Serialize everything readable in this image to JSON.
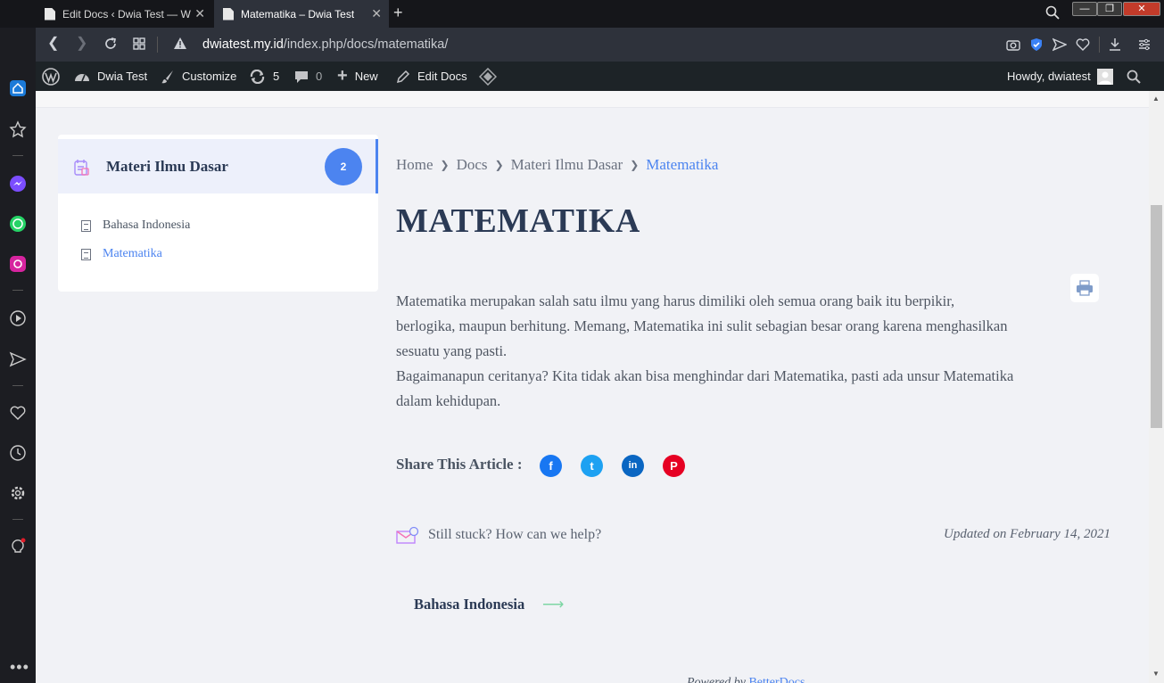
{
  "browser": {
    "tabs": [
      {
        "label": "Edit Docs ‹ Dwia Test — W",
        "close": "✕"
      },
      {
        "label": "Matematika – Dwia Test",
        "close": "✕"
      }
    ],
    "new_tab": "+",
    "url_domain": "dwiatest.my.id",
    "url_path": "/index.php/docs/matematika/"
  },
  "wp_admin_bar": {
    "site_name": "Dwia Test",
    "customize": "Customize",
    "updates_count": "5",
    "comments_count": "0",
    "new": "New",
    "edit_docs": "Edit Docs",
    "howdy": "Howdy, dwiatest"
  },
  "sidebar": {
    "title": "Materi Ilmu Dasar",
    "badge": "2",
    "items": [
      {
        "label": "Bahasa Indonesia",
        "active": false
      },
      {
        "label": "Matematika",
        "active": true
      }
    ]
  },
  "breadcrumb": [
    "Home",
    "Docs",
    "Materi Ilmu Dasar",
    "Matematika"
  ],
  "page_title": "MATEMATIKA",
  "article": {
    "lines": [
      "Matematika merupakan salah satu ilmu yang harus dimiliki oleh semua orang baik itu berpikir,",
      "berlogika, maupun berhitung. Memang, Matematika ini sulit sebagian besar orang karena menghasilkan",
      "sesuatu yang pasti.",
      "Bagaimanapun ceritanya? Kita tidak akan bisa menghindar dari Matematika, pasti ada unsur Matematika",
      "dalam kehidupan."
    ]
  },
  "share": {
    "label": "Share This Article :",
    "networks": [
      {
        "name": "facebook-icon",
        "glyph": "f",
        "color": "#1877f2"
      },
      {
        "name": "twitter-icon",
        "glyph": "t",
        "color": "#1da1f2"
      },
      {
        "name": "linkedin-icon",
        "glyph": "in",
        "color": "#0a66c2"
      },
      {
        "name": "pinterest-icon",
        "glyph": "P",
        "color": "#e60023"
      }
    ]
  },
  "help": "Still stuck? How can we help?",
  "updated": "Updated on February 14, 2021",
  "next_doc": "Bahasa Indonesia",
  "powered_by": {
    "prefix": "Powered by ",
    "link": "BetterDocs"
  },
  "colors": {
    "accent": "#4c84f0",
    "title": "#2b3a55"
  }
}
